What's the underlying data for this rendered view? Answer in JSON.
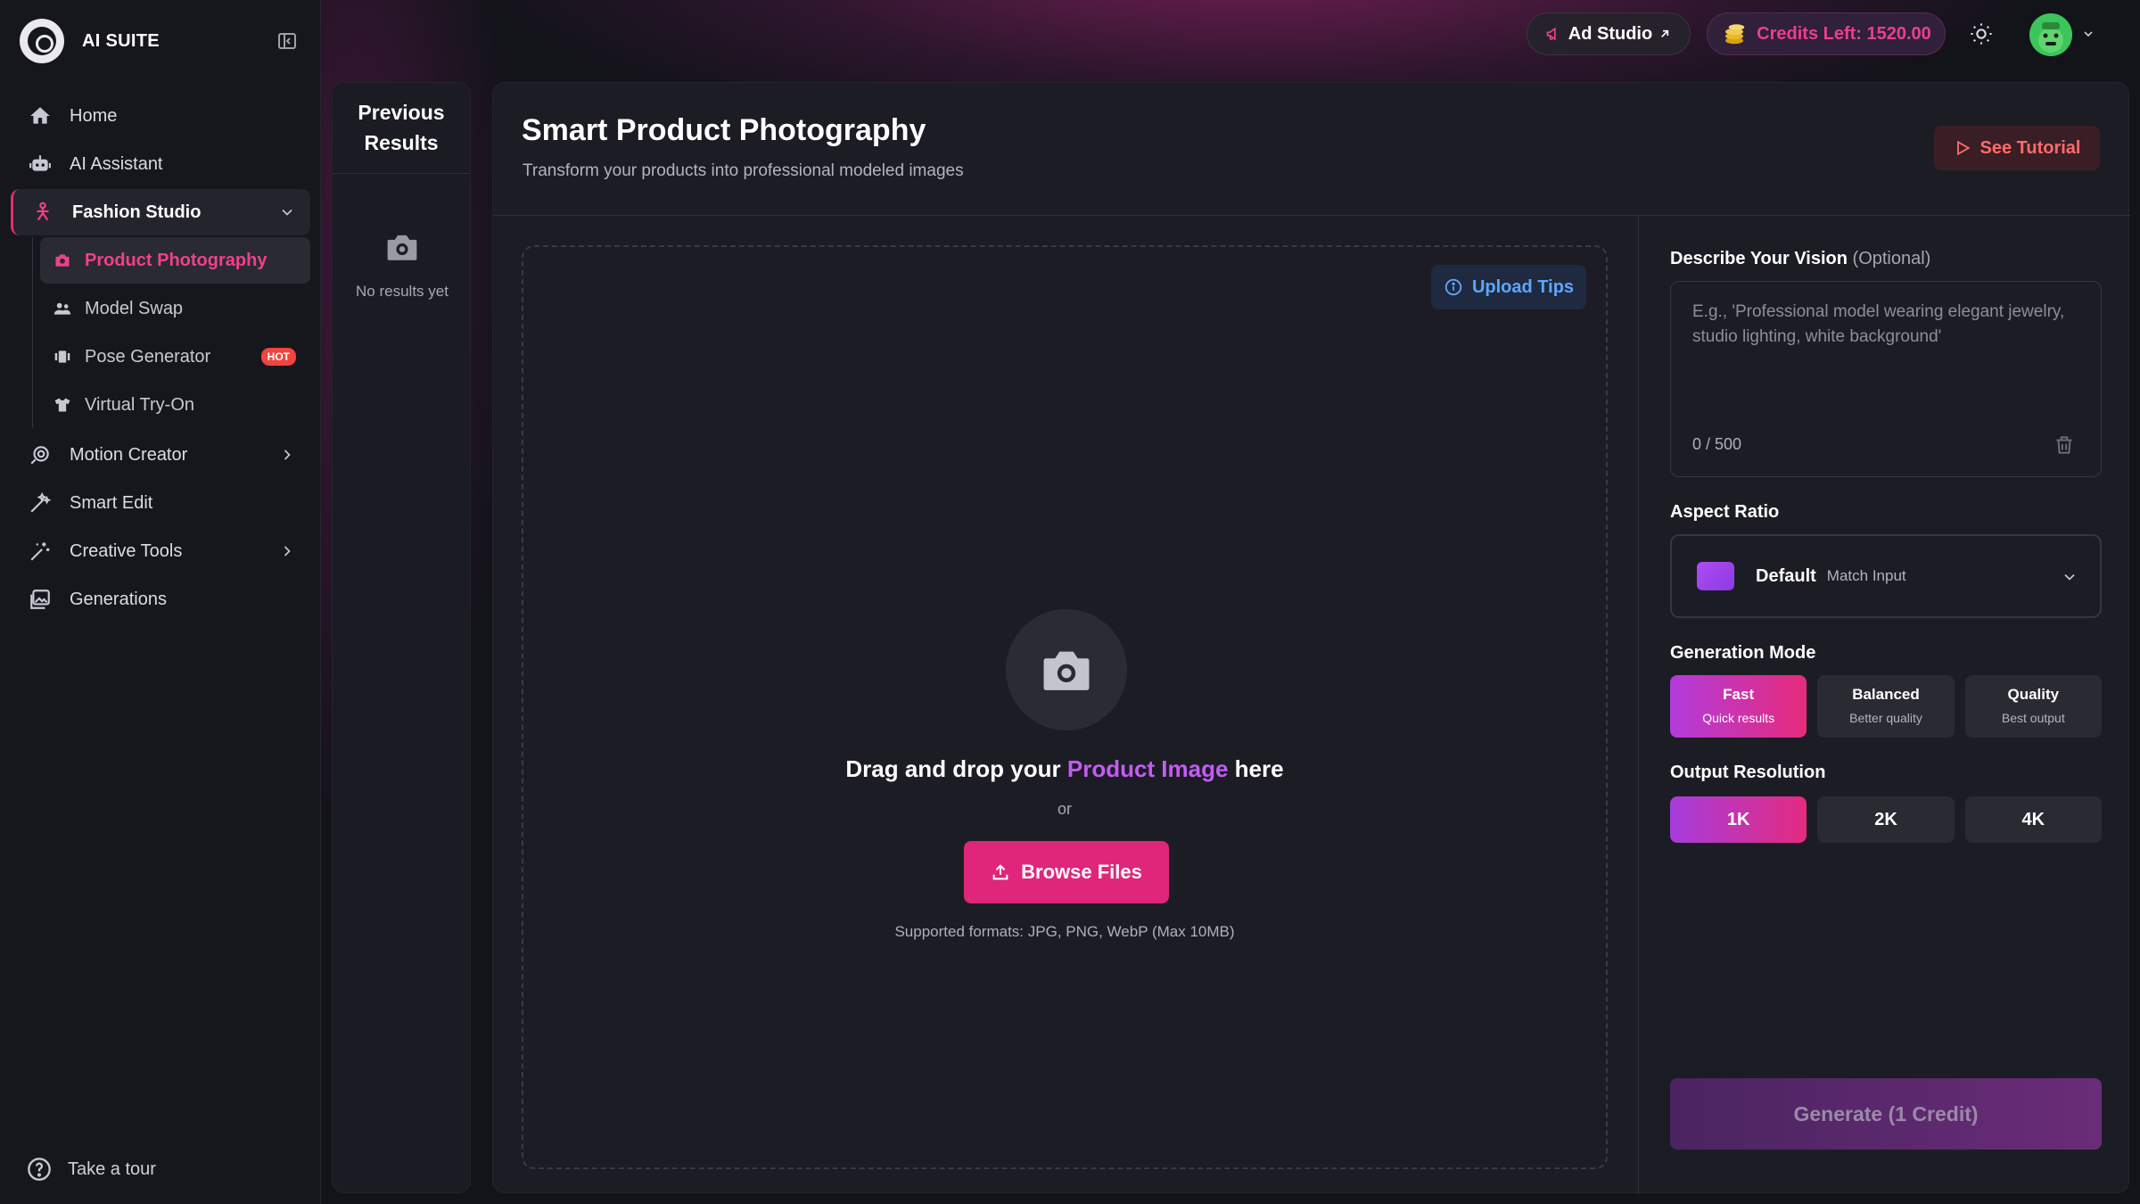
{
  "app": {
    "name": "AI SUITE"
  },
  "sidebar": {
    "items": [
      {
        "label": "Home",
        "icon": "home-icon"
      },
      {
        "label": "AI Assistant",
        "icon": "robot-icon"
      },
      {
        "label": "Fashion Studio",
        "icon": "model-icon"
      },
      {
        "label": "Motion Creator",
        "icon": "motion-icon"
      },
      {
        "label": "Smart Edit",
        "icon": "wand-icon"
      },
      {
        "label": "Creative Tools",
        "icon": "tools-icon"
      },
      {
        "label": "Generations",
        "icon": "gallery-icon"
      }
    ],
    "sub_items": [
      {
        "label": "Product Photography",
        "icon": "camera-icon"
      },
      {
        "label": "Model Swap",
        "icon": "users-icon"
      },
      {
        "label": "Pose Generator",
        "icon": "pose-icon",
        "badge": "HOT"
      },
      {
        "label": "Virtual Try-On",
        "icon": "shirt-icon"
      }
    ],
    "tour": "Take a tour"
  },
  "topbar": {
    "ad_studio": "Ad Studio",
    "credits": "Credits Left: 1520.00"
  },
  "previous": {
    "title_line1": "Previous",
    "title_line2": "Results",
    "empty": "No results yet"
  },
  "main": {
    "title": "Smart Product Photography",
    "subtitle": "Transform your products into professional modeled images",
    "tutorial": "See Tutorial",
    "upload_tips": "Upload Tips",
    "drag_pre": "Drag and drop your ",
    "drag_highlight": "Product Image",
    "drag_post": " here",
    "or": "or",
    "browse": "Browse Files",
    "formats": "Supported formats: JPG, PNG, WebP (Max 10MB)"
  },
  "panel": {
    "vision_label": "Describe Your Vision",
    "vision_optional": "(Optional)",
    "vision_placeholder": "E.g., 'Professional model wearing elegant jewelry, studio lighting, white background'",
    "vision_value": "",
    "counter": "0 / 500",
    "aspect_label": "Aspect Ratio",
    "aspect_value": "Default",
    "aspect_sub": "Match Input",
    "mode_label": "Generation Mode",
    "modes": [
      {
        "title": "Fast",
        "sub": "Quick results"
      },
      {
        "title": "Balanced",
        "sub": "Better quality"
      },
      {
        "title": "Quality",
        "sub": "Best output"
      }
    ],
    "res_label": "Output Resolution",
    "resolutions": [
      "1K",
      "2K",
      "4K"
    ],
    "generate": "Generate (1 Credit)"
  },
  "colors": {
    "accent": "#e0267a",
    "purple": "#c35cf2",
    "hot": "#f0443d",
    "bg": "#13131a"
  }
}
